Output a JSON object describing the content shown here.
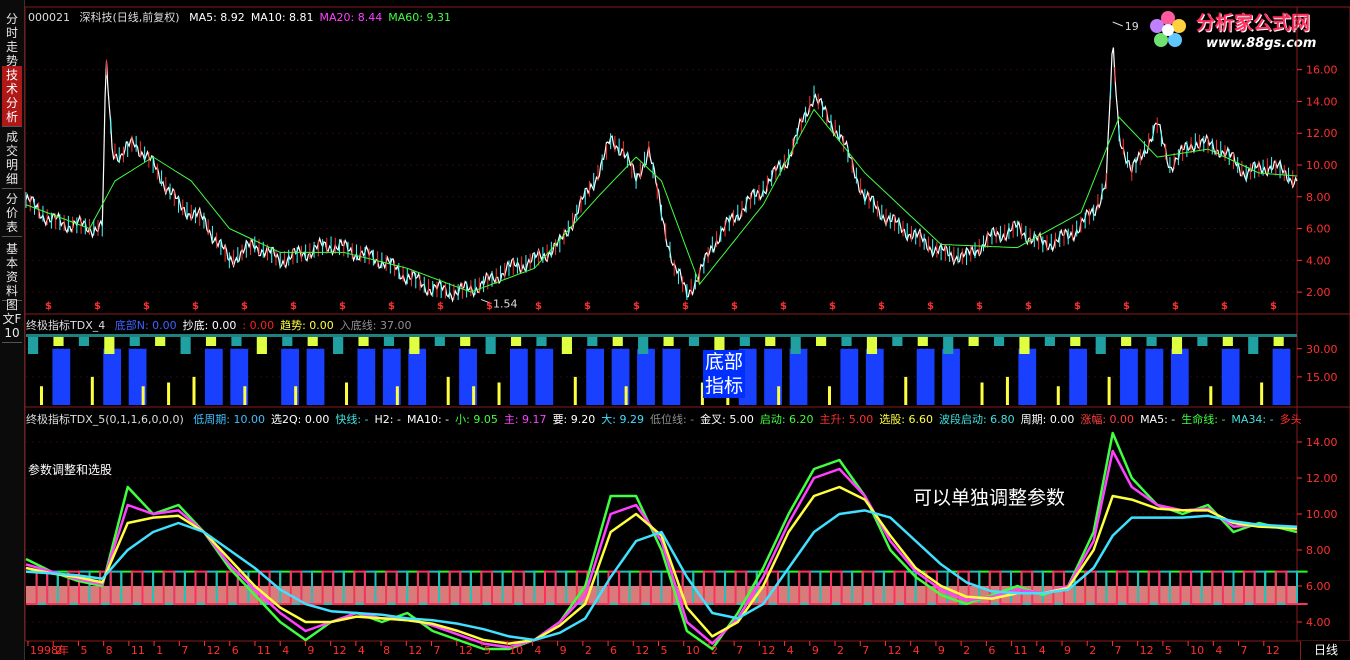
{
  "header": {
    "code": "000021",
    "name": "深科技(日线,前复权)",
    "ma": [
      {
        "label": "MA5: 8.92",
        "color": "#ffffff"
      },
      {
        "label": "MA10: 8.81",
        "color": "#ffffff"
      },
      {
        "label": "MA20: 8.44",
        "color": "#ff40ff"
      },
      {
        "label": "MA60: 9.31",
        "color": "#40ff40"
      }
    ]
  },
  "sidebar": {
    "items": [
      {
        "label": "分时走势",
        "active": false
      },
      {
        "label": "技术分析",
        "active": true
      },
      {
        "label": "成交明细",
        "active": false
      },
      {
        "label": "分价表",
        "active": false
      },
      {
        "label": "基本资料",
        "active": false
      },
      {
        "label": "图文F10",
        "active": false
      }
    ]
  },
  "logo": {
    "title": "分析家公式网",
    "url": "www.88gs.com"
  },
  "panel2": {
    "title": "终极指标TDX_4",
    "fields": [
      {
        "label": "底部N: 0.00",
        "color": "#4060ff"
      },
      {
        "label": "抄底: 0.00",
        "color": "#ffffff"
      },
      {
        "label": ": 0.00",
        "color": "#ff2020"
      },
      {
        "label": "趋势: 0.00",
        "color": "#ffff40"
      },
      {
        "label": "入底线: 37.00",
        "color": "#909090"
      }
    ],
    "annotation": "底部\n指标"
  },
  "panel3": {
    "title": "终极指标TDX_5(0,1,1,6,0,0,0)",
    "fields": [
      {
        "label": "低周期: 10.00",
        "color": "#40c0ff"
      },
      {
        "label": "选2Q: 0.00",
        "color": "#ffffff"
      },
      {
        "label": "快线: -",
        "color": "#40e0e0"
      },
      {
        "label": "H2: -",
        "color": "#ffffff"
      },
      {
        "label": "MA10: -",
        "color": "#ffffff"
      },
      {
        "label": "小: 9.05",
        "color": "#40ff40"
      },
      {
        "label": "主: 9.17",
        "color": "#ff40ff"
      },
      {
        "label": "要: 9.20",
        "color": "#ffffff"
      },
      {
        "label": "大: 9.29",
        "color": "#40e0ff"
      },
      {
        "label": "低位线: -",
        "color": "#909090"
      },
      {
        "label": "金叉: 5.00",
        "color": "#ffffff"
      },
      {
        "label": "启动: 6.20",
        "color": "#40ff40"
      },
      {
        "label": "主升: 5.00",
        "color": "#ff3030"
      },
      {
        "label": "选股: 6.60",
        "color": "#ffff40"
      },
      {
        "label": "波段启动: 6.80",
        "color": "#40e0e0"
      },
      {
        "label": "周期: 0.00",
        "color": "#ffffff"
      },
      {
        "label": "涨幅: 0.00",
        "color": "#ff4040"
      },
      {
        "label": "MA5: -",
        "color": "#ffffff"
      },
      {
        "label": "生命线: -",
        "color": "#40ff40"
      },
      {
        "label": "MA34: -",
        "color": "#40e0e0"
      },
      {
        "label": "多头",
        "color": "#ff3030"
      }
    ],
    "subtitle": "参数调整和选股",
    "annotation": "可以单独调整参数"
  },
  "footer": {
    "right_label": "日线"
  },
  "chart_data": [
    {
      "type": "line",
      "title": "000021 深科技(日线,前复权)",
      "ylim": [
        1.0,
        19.0
      ],
      "yticks": [
        "2.00",
        "4.00",
        "6.00",
        "8.00",
        "10.00",
        "12.00",
        "14.00",
        "16.00"
      ],
      "annotations": [
        {
          "label": "19",
          "x": 0.855,
          "y": 19.0
        },
        {
          "label": "1.54",
          "x": 0.358,
          "y": 1.54
        }
      ],
      "series": [
        {
          "name": "MA5: 8.92",
          "color": "#ffffff",
          "x": [
            0,
            0.02,
            0.04,
            0.06,
            0.063,
            0.068,
            0.075,
            0.085,
            0.1,
            0.12,
            0.14,
            0.16,
            0.18,
            0.2,
            0.22,
            0.24,
            0.26,
            0.28,
            0.3,
            0.32,
            0.34,
            0.36,
            0.38,
            0.4,
            0.42,
            0.44,
            0.45,
            0.46,
            0.47,
            0.48,
            0.49,
            0.5,
            0.51,
            0.52,
            0.53,
            0.54,
            0.56,
            0.58,
            0.6,
            0.62,
            0.63,
            0.64,
            0.65,
            0.66,
            0.68,
            0.7,
            0.72,
            0.74,
            0.76,
            0.78,
            0.8,
            0.82,
            0.84,
            0.85,
            0.855,
            0.86,
            0.87,
            0.88,
            0.89,
            0.9,
            0.92,
            0.94,
            0.96,
            0.98,
            1.0
          ],
          "y": [
            7.8,
            6.5,
            6.2,
            6.0,
            16.5,
            11.0,
            10.5,
            11.5,
            10.0,
            7.5,
            6.5,
            4.0,
            5.0,
            4.0,
            4.5,
            5.0,
            4.5,
            4.0,
            3.0,
            2.2,
            2.0,
            2.5,
            3.5,
            4.0,
            5.0,
            8.0,
            9.5,
            11.5,
            11.0,
            9.0,
            11.0,
            7.0,
            3.5,
            2.0,
            3.0,
            5.0,
            7.0,
            8.5,
            10.5,
            14.5,
            13.0,
            12.0,
            10.0,
            8.0,
            6.5,
            5.5,
            4.5,
            4.2,
            5.5,
            6.0,
            5.0,
            5.5,
            7.0,
            9.0,
            17.5,
            12.0,
            9.5,
            11.0,
            12.5,
            10.0,
            11.5,
            11.0,
            9.5,
            10.0,
            9.0
          ]
        },
        {
          "name": "MA60: 9.31",
          "color": "#40ff40",
          "x": [
            0,
            0.05,
            0.07,
            0.1,
            0.13,
            0.16,
            0.2,
            0.25,
            0.3,
            0.35,
            0.4,
            0.45,
            0.48,
            0.5,
            0.53,
            0.58,
            0.62,
            0.66,
            0.72,
            0.78,
            0.83,
            0.86,
            0.89,
            0.93,
            0.97,
            1.0
          ],
          "y": [
            7.5,
            6.0,
            9.0,
            10.5,
            9.0,
            6.0,
            4.5,
            4.5,
            3.5,
            2.0,
            3.5,
            8.0,
            10.5,
            9.0,
            2.5,
            7.5,
            13.5,
            9.5,
            5.0,
            4.8,
            7.0,
            13.0,
            10.5,
            11.0,
            9.5,
            9.31
          ]
        }
      ]
    },
    {
      "type": "bar",
      "title": "终极指标TDX_4",
      "ylim": [
        0,
        40
      ],
      "yticks": [
        "15.00",
        "30.00"
      ],
      "series": [
        {
          "name": "底部N",
          "color": "#1a40ff",
          "values": [
            0,
            30,
            0,
            30,
            30,
            0,
            0,
            30,
            30,
            0,
            30,
            30,
            0,
            30,
            30,
            30,
            0,
            30,
            0,
            30,
            30,
            0,
            30,
            30,
            30,
            30,
            0,
            0,
            30,
            30,
            30,
            0,
            30,
            30,
            0,
            30,
            30,
            0,
            0,
            30,
            0,
            30,
            0,
            30,
            30,
            30,
            0,
            30,
            0,
            30
          ]
        },
        {
          "name": "趋势",
          "color": "#ffff40",
          "values": [
            10,
            0,
            15,
            0,
            10,
            12,
            15,
            0,
            10,
            0,
            10,
            0,
            12,
            0,
            10,
            0,
            15,
            10,
            12,
            0,
            0,
            15,
            0,
            10,
            0,
            0,
            12,
            15,
            0,
            10,
            0,
            10,
            0,
            0,
            15,
            0,
            0,
            12,
            15,
            0,
            10,
            0,
            15,
            0,
            0,
            0,
            10,
            0,
            12,
            0
          ]
        }
      ]
    },
    {
      "type": "line",
      "title": "终极指标TDX_5(0,1,1,6,0,0,0)",
      "ylim": [
        3.0,
        15.0
      ],
      "yticks": [
        "4.00",
        "6.00",
        "8.00",
        "10.00",
        "12.00",
        "14.00"
      ],
      "x": [
        0,
        0.02,
        0.04,
        0.06,
        0.08,
        0.1,
        0.12,
        0.14,
        0.16,
        0.18,
        0.2,
        0.22,
        0.24,
        0.26,
        0.28,
        0.3,
        0.32,
        0.34,
        0.36,
        0.38,
        0.4,
        0.42,
        0.44,
        0.46,
        0.48,
        0.5,
        0.52,
        0.54,
        0.56,
        0.58,
        0.6,
        0.62,
        0.64,
        0.66,
        0.68,
        0.7,
        0.72,
        0.74,
        0.76,
        0.78,
        0.8,
        0.82,
        0.84,
        0.855,
        0.87,
        0.89,
        0.91,
        0.93,
        0.95,
        0.97,
        1.0
      ],
      "series": [
        {
          "name": "小: 9.05",
          "color": "#40ff40",
          "values": [
            7.5,
            6.8,
            6.3,
            6.0,
            11.5,
            10.0,
            10.5,
            9.0,
            7.0,
            5.5,
            4.0,
            3.0,
            4.0,
            4.5,
            4.0,
            4.5,
            3.5,
            3.0,
            2.5,
            2.5,
            3.0,
            4.0,
            6.0,
            11.0,
            11.0,
            8.0,
            3.5,
            2.5,
            4.5,
            7.0,
            10.0,
            12.5,
            13.0,
            11.0,
            8.0,
            6.5,
            5.5,
            5.0,
            5.5,
            6.0,
            5.5,
            6.0,
            9.0,
            14.5,
            12.0,
            10.5,
            10.0,
            10.5,
            9.0,
            9.5,
            9.0
          ]
        },
        {
          "name": "主: 9.17",
          "color": "#ff40ff",
          "values": [
            7.2,
            6.8,
            6.4,
            6.1,
            10.5,
            10.0,
            10.2,
            9.0,
            7.2,
            5.8,
            4.5,
            3.5,
            4.0,
            4.5,
            4.2,
            4.2,
            3.8,
            3.3,
            2.8,
            2.6,
            3.0,
            4.0,
            5.5,
            10.0,
            10.5,
            8.5,
            4.0,
            2.8,
            4.2,
            6.5,
            9.5,
            12.0,
            12.5,
            11.0,
            8.5,
            6.8,
            5.8,
            5.2,
            5.4,
            5.8,
            5.6,
            6.0,
            8.5,
            13.5,
            11.5,
            10.5,
            10.2,
            10.3,
            9.3,
            9.4,
            9.17
          ]
        },
        {
          "name": "要: 9.20",
          "color": "#ffff40",
          "values": [
            7.0,
            6.7,
            6.5,
            6.2,
            9.5,
            9.8,
            9.9,
            9.0,
            7.5,
            6.0,
            4.8,
            4.0,
            4.0,
            4.3,
            4.2,
            4.1,
            3.9,
            3.5,
            3.0,
            2.8,
            3.0,
            3.8,
            5.0,
            9.0,
            10.0,
            8.8,
            4.8,
            3.2,
            4.0,
            6.0,
            9.0,
            11.0,
            11.5,
            10.8,
            8.8,
            7.0,
            6.0,
            5.4,
            5.3,
            5.6,
            5.6,
            5.9,
            8.0,
            11.0,
            10.8,
            10.3,
            10.2,
            10.2,
            9.5,
            9.3,
            9.2
          ]
        },
        {
          "name": "大: 9.29",
          "color": "#40e0ff",
          "values": [
            6.8,
            6.7,
            6.6,
            6.4,
            8.0,
            9.0,
            9.5,
            9.0,
            8.0,
            7.0,
            5.8,
            5.0,
            4.6,
            4.5,
            4.4,
            4.2,
            4.1,
            3.9,
            3.6,
            3.2,
            3.0,
            3.4,
            4.2,
            6.5,
            8.5,
            9.0,
            6.5,
            4.5,
            4.2,
            5.0,
            7.0,
            9.0,
            10.0,
            10.2,
            9.8,
            8.5,
            7.2,
            6.2,
            5.7,
            5.6,
            5.6,
            5.8,
            7.0,
            8.8,
            9.8,
            9.8,
            9.8,
            9.9,
            9.6,
            9.4,
            9.29
          ]
        }
      ]
    }
  ],
  "x_axis": {
    "labels": [
      "1998年",
      "2",
      "5",
      "8",
      "11",
      "1",
      "7",
      "12",
      "6",
      "11",
      "4",
      "9",
      "12",
      "4",
      "8",
      "12",
      "7",
      "12",
      "5",
      "10",
      "4",
      "9",
      "2",
      "6",
      "12",
      "5",
      "10",
      "2",
      "7",
      "12",
      "4",
      "9",
      "2",
      "7",
      "12",
      "4",
      "9",
      "2",
      "6",
      "11",
      "4",
      "9",
      "2",
      "7",
      "12",
      "5",
      "10",
      "4",
      "7",
      "12"
    ]
  }
}
